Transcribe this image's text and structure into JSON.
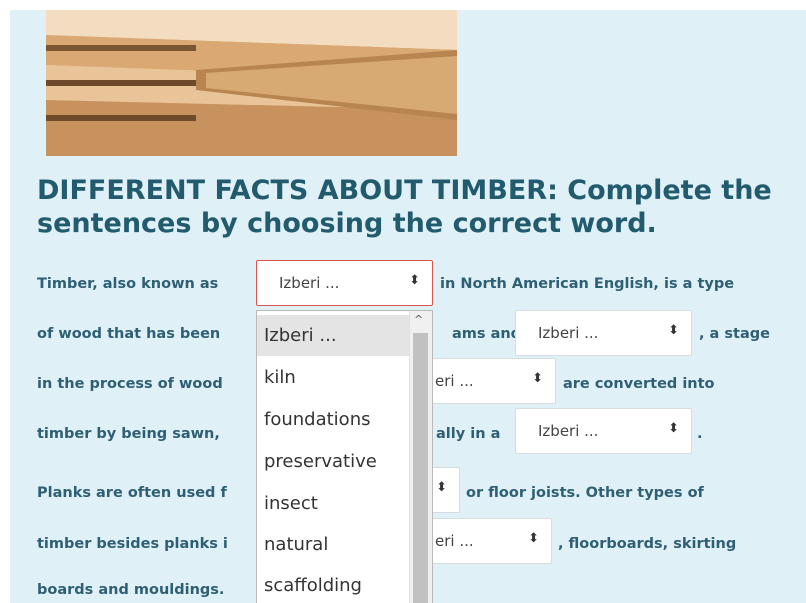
{
  "heading": "DIFFERENT FACTS ABOUT TIMBER: Complete the sentences by choosing the correct word.",
  "image_alt": "Stacked sawn timber planks",
  "select_placeholder": "Izberi ...",
  "lines": {
    "l1a": "Timber, also known as",
    "l1b": "in North American English, is a type",
    "l2a": "of wood that has been",
    "l2b": "ams and",
    "l2c": ", a stage",
    "l3a": "in the process of wood",
    "l3b": "are converted into",
    "l4a": "timber by being sawn,",
    "l4b": "ally in a",
    "l4c": ".",
    "l5a": "Planks are often used f",
    "l5b": "or floor joists. Other types of",
    "l6a": "timber besides planks i",
    "l6b": ", floorboards, skirting",
    "l7a": "boards and mouldings."
  },
  "partial_selects": {
    "s3": "eri ...",
    "s6": "eri ..."
  },
  "dropdown": {
    "options": [
      "Izberi ...",
      "kiln",
      "foundations",
      "preservative",
      "insect",
      "natural",
      "scaffolding"
    ],
    "highlighted_index": 0
  },
  "icons": {
    "select_arrow": "up-down-arrow-icon",
    "scroll_up": "scroll-up-icon"
  },
  "colors": {
    "panel_bg": "#dff0f6",
    "heading": "#225a6e",
    "text": "#2f5f74",
    "open_border": "#d9534f"
  }
}
